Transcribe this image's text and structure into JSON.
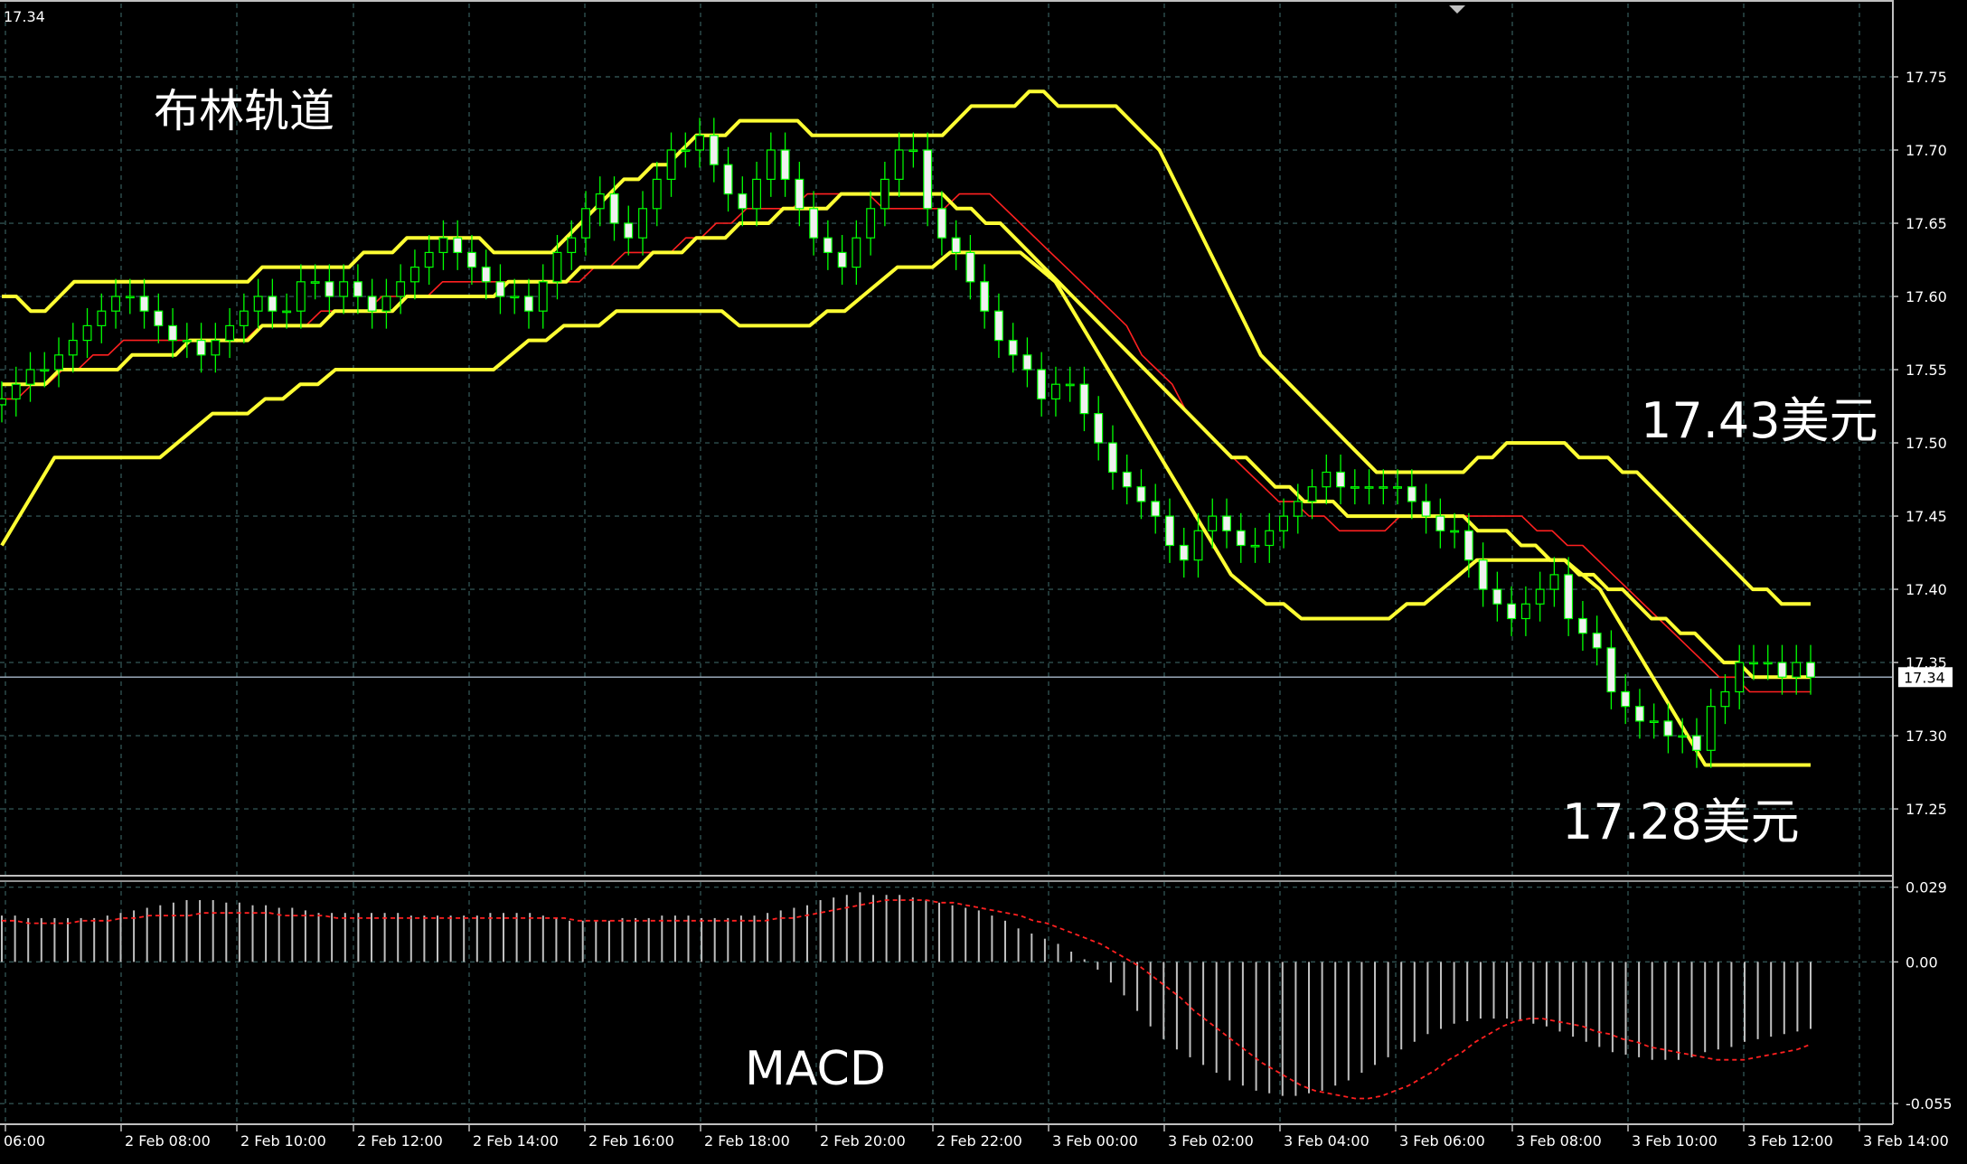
{
  "colors": {
    "background": "#000000",
    "grid": "#2f4f4f",
    "bull_candle": "#00ff00",
    "bear_candle": "#f0f0f0",
    "bollinger": "#ffff33",
    "ma": "#ff2020",
    "macd_hist": "#c0c0c0",
    "macd_signal": "#ff2020",
    "axis": "#c0c0c0",
    "current_price_line": "#9aa8b8"
  },
  "top_left_price": "17.34",
  "annotations": {
    "title": "布林轨道",
    "upper_value": "17.43美元",
    "lower_value": "17.28美元",
    "macd_label": "MACD"
  },
  "chart_data": [
    {
      "type": "candlestick",
      "indicator": "Bollinger Bands",
      "ylim": [
        17.205,
        17.8
      ],
      "ticks": [
        "17.75",
        "17.70",
        "17.65",
        "17.60",
        "17.55",
        "17.50",
        "17.45",
        "17.40",
        "17.35",
        "17.30",
        "17.25"
      ],
      "tick_values": [
        17.75,
        17.7,
        17.65,
        17.6,
        17.55,
        17.5,
        17.45,
        17.4,
        17.35,
        17.3,
        17.25
      ],
      "current_price": 17.34,
      "current_price_label": "17.34",
      "x_labels": [
        "06:00",
        "2 Feb 08:00",
        "2 Feb 10:00",
        "2 Feb 12:00",
        "2 Feb 14:00",
        "2 Feb 16:00",
        "2 Feb 18:00",
        "2 Feb 20:00",
        "2 Feb 22:00",
        "3 Feb 00:00",
        "3 Feb 02:00",
        "3 Feb 04:00",
        "3 Feb 06:00",
        "3 Feb 08:00",
        "3 Feb 10:00",
        "3 Feb 12:00",
        "3 Feb 14:00"
      ],
      "close": [
        17.53,
        17.54,
        17.55,
        17.55,
        17.56,
        17.57,
        17.58,
        17.59,
        17.6,
        17.6,
        17.59,
        17.58,
        17.57,
        17.57,
        17.56,
        17.57,
        17.58,
        17.59,
        17.6,
        17.59,
        17.59,
        17.61,
        17.61,
        17.6,
        17.61,
        17.6,
        17.59,
        17.6,
        17.61,
        17.62,
        17.63,
        17.64,
        17.63,
        17.62,
        17.61,
        17.6,
        17.6,
        17.59,
        17.61,
        17.63,
        17.64,
        17.66,
        17.67,
        17.65,
        17.64,
        17.66,
        17.68,
        17.7,
        17.7,
        17.71,
        17.69,
        17.67,
        17.66,
        17.68,
        17.7,
        17.68,
        17.66,
        17.64,
        17.63,
        17.62,
        17.64,
        17.66,
        17.68,
        17.7,
        17.7,
        17.66,
        17.64,
        17.63,
        17.61,
        17.59,
        17.57,
        17.56,
        17.55,
        17.53,
        17.54,
        17.54,
        17.52,
        17.5,
        17.48,
        17.47,
        17.46,
        17.45,
        17.43,
        17.42,
        17.44,
        17.45,
        17.44,
        17.43,
        17.43,
        17.44,
        17.45,
        17.46,
        17.47,
        17.48,
        17.47,
        17.47,
        17.47,
        17.47,
        17.47,
        17.46,
        17.45,
        17.44,
        17.44,
        17.42,
        17.4,
        17.39,
        17.38,
        17.39,
        17.4,
        17.41,
        17.38,
        17.37,
        17.36,
        17.33,
        17.32,
        17.31,
        17.31,
        17.3,
        17.3,
        17.29,
        17.32,
        17.33,
        17.35,
        17.35,
        17.35,
        17.34,
        17.35,
        17.34
      ],
      "bb_upper": [
        17.6,
        17.6,
        17.59,
        17.59,
        17.6,
        17.61,
        17.61,
        17.61,
        17.61,
        17.61,
        17.61,
        17.61,
        17.61,
        17.61,
        17.61,
        17.61,
        17.61,
        17.61,
        17.62,
        17.62,
        17.62,
        17.62,
        17.62,
        17.62,
        17.62,
        17.63,
        17.63,
        17.63,
        17.64,
        17.64,
        17.64,
        17.64,
        17.64,
        17.64,
        17.63,
        17.63,
        17.63,
        17.63,
        17.63,
        17.64,
        17.65,
        17.66,
        17.67,
        17.68,
        17.68,
        17.69,
        17.69,
        17.7,
        17.71,
        17.71,
        17.71,
        17.72,
        17.72,
        17.72,
        17.72,
        17.72,
        17.71,
        17.71,
        17.71,
        17.71,
        17.71,
        17.71,
        17.71,
        17.71,
        17.71,
        17.71,
        17.72,
        17.73,
        17.73,
        17.73,
        17.73,
        17.74,
        17.74,
        17.73,
        17.73,
        17.73,
        17.73,
        17.73,
        17.72,
        17.71,
        17.7,
        17.68,
        17.66,
        17.64,
        17.62,
        17.6,
        17.58,
        17.56,
        17.55,
        17.54,
        17.53,
        17.52,
        17.51,
        17.5,
        17.49,
        17.48,
        17.48,
        17.48,
        17.48,
        17.48,
        17.48,
        17.48,
        17.49,
        17.49,
        17.5,
        17.5,
        17.5,
        17.5,
        17.5,
        17.49,
        17.49,
        17.49,
        17.48,
        17.48,
        17.47,
        17.46,
        17.45,
        17.44,
        17.43,
        17.42,
        17.41,
        17.4,
        17.4,
        17.39,
        17.39,
        17.39
      ],
      "bb_middle": [
        17.54,
        17.54,
        17.54,
        17.54,
        17.55,
        17.55,
        17.55,
        17.55,
        17.55,
        17.56,
        17.56,
        17.56,
        17.56,
        17.57,
        17.57,
        17.57,
        17.57,
        17.57,
        17.58,
        17.58,
        17.58,
        17.58,
        17.58,
        17.59,
        17.59,
        17.59,
        17.59,
        17.59,
        17.6,
        17.6,
        17.6,
        17.6,
        17.6,
        17.6,
        17.6,
        17.61,
        17.61,
        17.61,
        17.61,
        17.61,
        17.62,
        17.62,
        17.62,
        17.62,
        17.62,
        17.63,
        17.63,
        17.63,
        17.64,
        17.64,
        17.64,
        17.65,
        17.65,
        17.65,
        17.66,
        17.66,
        17.66,
        17.66,
        17.67,
        17.67,
        17.67,
        17.67,
        17.67,
        17.67,
        17.67,
        17.67,
        17.66,
        17.66,
        17.65,
        17.65,
        17.64,
        17.63,
        17.62,
        17.61,
        17.6,
        17.59,
        17.58,
        17.57,
        17.56,
        17.55,
        17.54,
        17.53,
        17.52,
        17.51,
        17.5,
        17.49,
        17.49,
        17.48,
        17.47,
        17.47,
        17.46,
        17.46,
        17.46,
        17.45,
        17.45,
        17.45,
        17.45,
        17.45,
        17.45,
        17.45,
        17.45,
        17.45,
        17.44,
        17.44,
        17.44,
        17.43,
        17.43,
        17.42,
        17.42,
        17.41,
        17.41,
        17.4,
        17.4,
        17.39,
        17.38,
        17.38,
        17.37,
        17.37,
        17.36,
        17.35,
        17.35,
        17.34,
        17.34,
        17.34,
        17.34,
        17.34
      ],
      "bb_lower": [
        17.43,
        17.45,
        17.47,
        17.49,
        17.49,
        17.49,
        17.49,
        17.49,
        17.49,
        17.49,
        17.5,
        17.51,
        17.52,
        17.52,
        17.52,
        17.53,
        17.53,
        17.54,
        17.54,
        17.55,
        17.55,
        17.55,
        17.55,
        17.55,
        17.55,
        17.55,
        17.55,
        17.55,
        17.55,
        17.56,
        17.57,
        17.57,
        17.58,
        17.58,
        17.58,
        17.59,
        17.59,
        17.59,
        17.59,
        17.59,
        17.59,
        17.59,
        17.58,
        17.58,
        17.58,
        17.58,
        17.58,
        17.59,
        17.59,
        17.6,
        17.61,
        17.62,
        17.62,
        17.62,
        17.63,
        17.63,
        17.63,
        17.63,
        17.63,
        17.62,
        17.61,
        17.59,
        17.57,
        17.55,
        17.53,
        17.51,
        17.49,
        17.47,
        17.45,
        17.43,
        17.41,
        17.4,
        17.39,
        17.39,
        17.38,
        17.38,
        17.38,
        17.38,
        17.38,
        17.38,
        17.39,
        17.39,
        17.4,
        17.41,
        17.42,
        17.42,
        17.42,
        17.42,
        17.42,
        17.42,
        17.41,
        17.4,
        17.38,
        17.36,
        17.34,
        17.32,
        17.3,
        17.28,
        17.28,
        17.28,
        17.28,
        17.28,
        17.28,
        17.28
      ],
      "ma_red": [
        17.53,
        17.53,
        17.54,
        17.54,
        17.55,
        17.55,
        17.56,
        17.56,
        17.57,
        17.57,
        17.57,
        17.57,
        17.57,
        17.57,
        17.57,
        17.57,
        17.57,
        17.58,
        17.58,
        17.58,
        17.58,
        17.59,
        17.59,
        17.59,
        17.59,
        17.6,
        17.6,
        17.6,
        17.6,
        17.61,
        17.61,
        17.61,
        17.61,
        17.61,
        17.61,
        17.61,
        17.61,
        17.61,
        17.61,
        17.62,
        17.62,
        17.63,
        17.63,
        17.63,
        17.63,
        17.64,
        17.64,
        17.65,
        17.65,
        17.66,
        17.66,
        17.66,
        17.66,
        17.67,
        17.67,
        17.67,
        17.67,
        17.67,
        17.66,
        17.66,
        17.66,
        17.66,
        17.66,
        17.67,
        17.67,
        17.67,
        17.66,
        17.65,
        17.64,
        17.63,
        17.62,
        17.61,
        17.6,
        17.59,
        17.58,
        17.56,
        17.55,
        17.54,
        17.52,
        17.51,
        17.5,
        17.49,
        17.48,
        17.47,
        17.46,
        17.46,
        17.45,
        17.45,
        17.44,
        17.44,
        17.44,
        17.44,
        17.45,
        17.45,
        17.45,
        17.45,
        17.45,
        17.45,
        17.45,
        17.45,
        17.45,
        17.44,
        17.44,
        17.43,
        17.43,
        17.42,
        17.41,
        17.4,
        17.39,
        17.38,
        17.37,
        17.36,
        17.35,
        17.34,
        17.34,
        17.33,
        17.33,
        17.33,
        17.33,
        17.33
      ]
    },
    {
      "type": "bar",
      "indicator": "MACD",
      "ylim": [
        -0.063,
        0.031
      ],
      "ticks": [
        "0.029",
        "0.00",
        "-0.055"
      ],
      "tick_values": [
        0.029,
        0.0,
        -0.055
      ],
      "histogram": [
        0.018,
        0.018,
        0.017,
        0.017,
        0.017,
        0.017,
        0.017,
        0.017,
        0.018,
        0.019,
        0.02,
        0.021,
        0.022,
        0.023,
        0.024,
        0.024,
        0.024,
        0.023,
        0.023,
        0.022,
        0.022,
        0.021,
        0.021,
        0.02,
        0.019,
        0.019,
        0.019,
        0.019,
        0.019,
        0.019,
        0.019,
        0.018,
        0.018,
        0.018,
        0.018,
        0.018,
        0.018,
        0.019,
        0.019,
        0.019,
        0.019,
        0.018,
        0.017,
        0.016,
        0.016,
        0.016,
        0.016,
        0.017,
        0.017,
        0.017,
        0.018,
        0.018,
        0.018,
        0.017,
        0.017,
        0.017,
        0.018,
        0.018,
        0.019,
        0.02,
        0.021,
        0.022,
        0.024,
        0.025,
        0.026,
        0.027,
        0.026,
        0.026,
        0.026,
        0.025,
        0.024,
        0.023,
        0.022,
        0.021,
        0.02,
        0.018,
        0.016,
        0.013,
        0.011,
        0.009,
        0.007,
        0.004,
        0.001,
        -0.003,
        -0.008,
        -0.013,
        -0.019,
        -0.025,
        -0.03,
        -0.034,
        -0.037,
        -0.04,
        -0.043,
        -0.046,
        -0.048,
        -0.05,
        -0.051,
        -0.052,
        -0.052,
        -0.051,
        -0.05,
        -0.048,
        -0.046,
        -0.043,
        -0.04,
        -0.037,
        -0.034,
        -0.031,
        -0.028,
        -0.026,
        -0.024,
        -0.023,
        -0.022,
        -0.022,
        -0.022,
        -0.023,
        -0.024,
        -0.025,
        -0.027,
        -0.029,
        -0.031,
        -0.033,
        -0.035,
        -0.036,
        -0.037,
        -0.038,
        -0.038,
        -0.038,
        -0.037,
        -0.035,
        -0.034,
        -0.033,
        -0.031,
        -0.03,
        -0.029,
        -0.028,
        -0.027,
        -0.026
      ],
      "signal": [
        0.016,
        0.016,
        0.015,
        0.015,
        0.015,
        0.015,
        0.016,
        0.016,
        0.016,
        0.017,
        0.017,
        0.018,
        0.018,
        0.018,
        0.018,
        0.019,
        0.019,
        0.019,
        0.019,
        0.019,
        0.019,
        0.018,
        0.018,
        0.018,
        0.018,
        0.017,
        0.017,
        0.017,
        0.017,
        0.017,
        0.017,
        0.017,
        0.017,
        0.017,
        0.017,
        0.017,
        0.017,
        0.017,
        0.017,
        0.017,
        0.017,
        0.017,
        0.017,
        0.016,
        0.016,
        0.016,
        0.016,
        0.016,
        0.016,
        0.016,
        0.016,
        0.016,
        0.016,
        0.016,
        0.016,
        0.016,
        0.016,
        0.016,
        0.017,
        0.017,
        0.018,
        0.019,
        0.02,
        0.021,
        0.022,
        0.023,
        0.024,
        0.024,
        0.024,
        0.024,
        0.023,
        0.023,
        0.022,
        0.021,
        0.02,
        0.019,
        0.018,
        0.016,
        0.015,
        0.013,
        0.011,
        0.009,
        0.007,
        0.004,
        0.001,
        -0.002,
        -0.006,
        -0.01,
        -0.014,
        -0.019,
        -0.023,
        -0.027,
        -0.031,
        -0.035,
        -0.039,
        -0.042,
        -0.045,
        -0.048,
        -0.05,
        -0.051,
        -0.052,
        -0.053,
        -0.053,
        -0.052,
        -0.05,
        -0.048,
        -0.045,
        -0.042,
        -0.038,
        -0.035,
        -0.031,
        -0.028,
        -0.025,
        -0.023,
        -0.022,
        -0.022,
        -0.023,
        -0.024,
        -0.025,
        -0.027,
        -0.028,
        -0.03,
        -0.031,
        -0.033,
        -0.034,
        -0.035,
        -0.036,
        -0.037,
        -0.038,
        -0.038,
        -0.038,
        -0.037,
        -0.036,
        -0.035,
        -0.034,
        -0.032
      ]
    }
  ]
}
